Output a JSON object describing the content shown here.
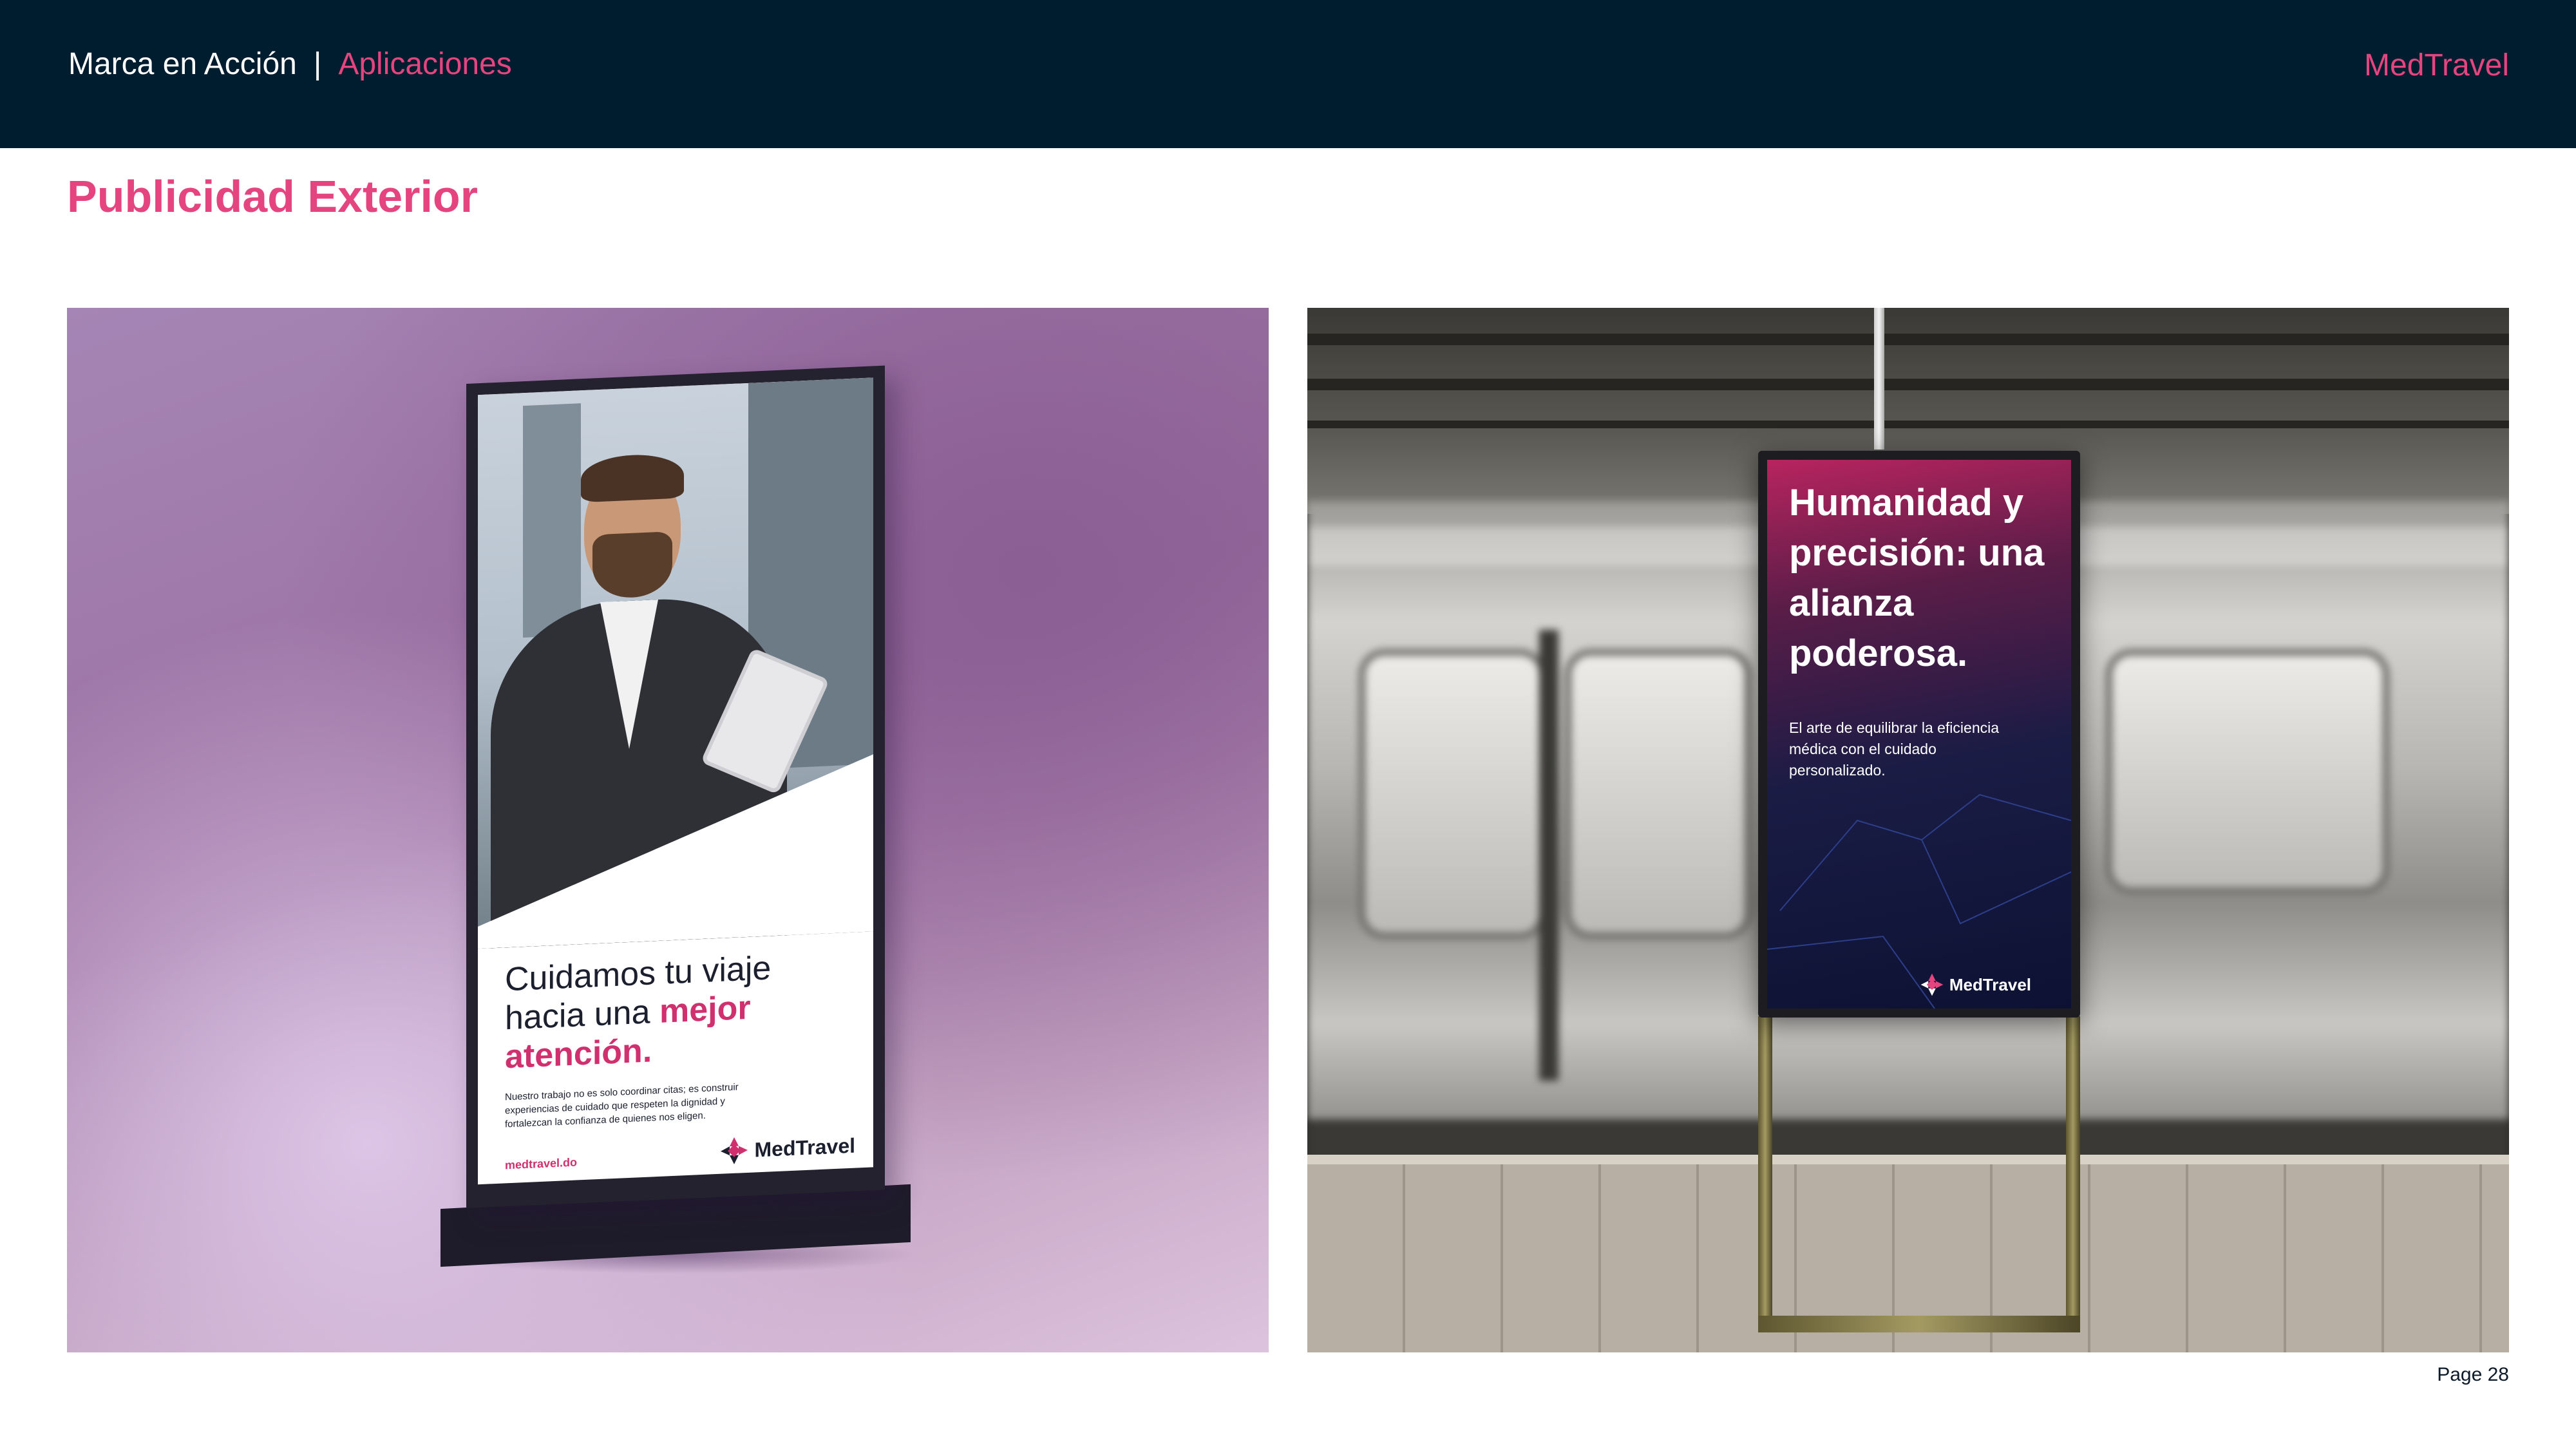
{
  "header": {
    "section": "Marca en Acción",
    "separator": "|",
    "subsection": "Aplicaciones",
    "brand": "MedTravel"
  },
  "page": {
    "title": "Publicidad Exterior",
    "page_number": "Page 28"
  },
  "mockups": {
    "totem": {
      "headline_part1": "Cuidamos tu viaje hacia una ",
      "headline_highlight": "mejor atención.",
      "body": "Nuestro trabajo no es solo coordinar citas; es construir experiencias de cuidado que respeten la dignidad y fortalezcan la confianza de quienes nos eligen.",
      "url": "medtravel.do",
      "logo_text": "MedTravel"
    },
    "subway_screen": {
      "headline": "Humanidad y precisión: una alianza poderosa.",
      "body": "El arte de equilibrar la eficiencia médica con el cuidado personalizado.",
      "logo_text": "MedTravel"
    }
  },
  "colors": {
    "header_bg": "#001c2f",
    "accent": "#e5457f",
    "text_dark": "#0c1a2a"
  }
}
